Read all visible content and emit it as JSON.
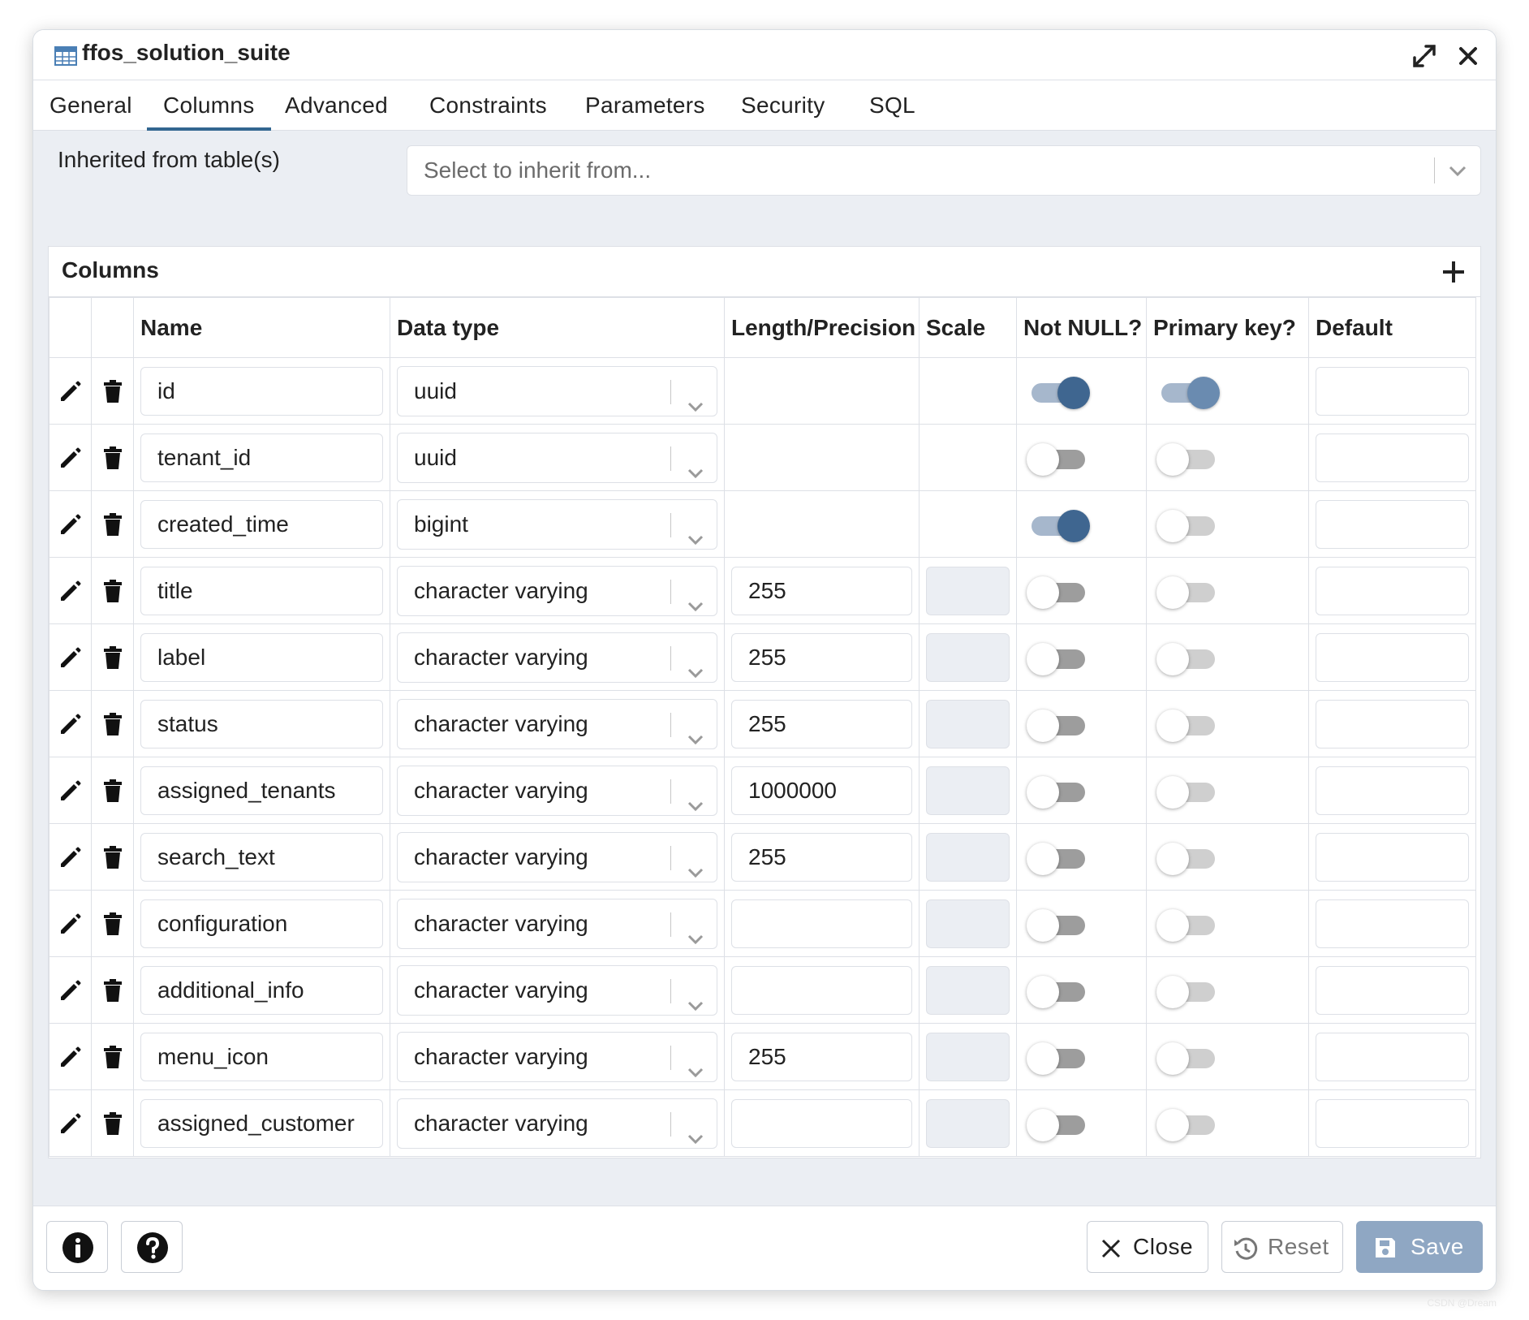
{
  "window": {
    "title": "ffos_solution_suite"
  },
  "tabs": [
    {
      "label": "General",
      "active": false
    },
    {
      "label": "Columns",
      "active": true
    },
    {
      "label": "Advanced",
      "active": false
    },
    {
      "label": "Constraints",
      "active": false
    },
    {
      "label": "Parameters",
      "active": false
    },
    {
      "label": "Security",
      "active": false
    },
    {
      "label": "SQL",
      "active": false
    }
  ],
  "inherit": {
    "label": "Inherited from table(s)",
    "placeholder": "Select to inherit from..."
  },
  "columns_panel": {
    "title": "Columns",
    "headers": [
      "Name",
      "Data type",
      "Length/Precision",
      "Scale",
      "Not NULL?",
      "Primary key?",
      "Default"
    ],
    "rows": [
      {
        "name": "id",
        "data_type": "uuid",
        "length": "",
        "scale": "",
        "not_null": true,
        "primary_key": true,
        "default": ""
      },
      {
        "name": "tenant_id",
        "data_type": "uuid",
        "length": "",
        "scale": "",
        "not_null": false,
        "primary_key": false,
        "default": ""
      },
      {
        "name": "created_time",
        "data_type": "bigint",
        "length": "",
        "scale": "",
        "not_null": true,
        "primary_key": false,
        "default": ""
      },
      {
        "name": "title",
        "data_type": "character varying",
        "length": "255",
        "scale": "",
        "not_null": false,
        "primary_key": false,
        "default": ""
      },
      {
        "name": "label",
        "data_type": "character varying",
        "length": "255",
        "scale": "",
        "not_null": false,
        "primary_key": false,
        "default": ""
      },
      {
        "name": "status",
        "data_type": "character varying",
        "length": "255",
        "scale": "",
        "not_null": false,
        "primary_key": false,
        "default": ""
      },
      {
        "name": "assigned_tenants",
        "data_type": "character varying",
        "length": "1000000",
        "scale": "",
        "not_null": false,
        "primary_key": false,
        "default": ""
      },
      {
        "name": "search_text",
        "data_type": "character varying",
        "length": "255",
        "scale": "",
        "not_null": false,
        "primary_key": false,
        "default": ""
      },
      {
        "name": "configuration",
        "data_type": "character varying",
        "length": "",
        "scale": "",
        "not_null": false,
        "primary_key": false,
        "default": ""
      },
      {
        "name": "additional_info",
        "data_type": "character varying",
        "length": "",
        "scale": "",
        "not_null": false,
        "primary_key": false,
        "default": ""
      },
      {
        "name": "menu_icon",
        "data_type": "character varying",
        "length": "255",
        "scale": "",
        "not_null": false,
        "primary_key": false,
        "default": ""
      },
      {
        "name": "assigned_customer",
        "data_type": "character varying",
        "length": "",
        "scale": "",
        "not_null": false,
        "primary_key": false,
        "default": ""
      }
    ]
  },
  "footer": {
    "close_label": "Close",
    "reset_label": "Reset",
    "save_label": "Save"
  },
  "colors": {
    "accent": "#326690",
    "toggle_on_knob": "#3f6690",
    "save_button": "#8fa7c3"
  },
  "watermark": "CSDN @Dream"
}
